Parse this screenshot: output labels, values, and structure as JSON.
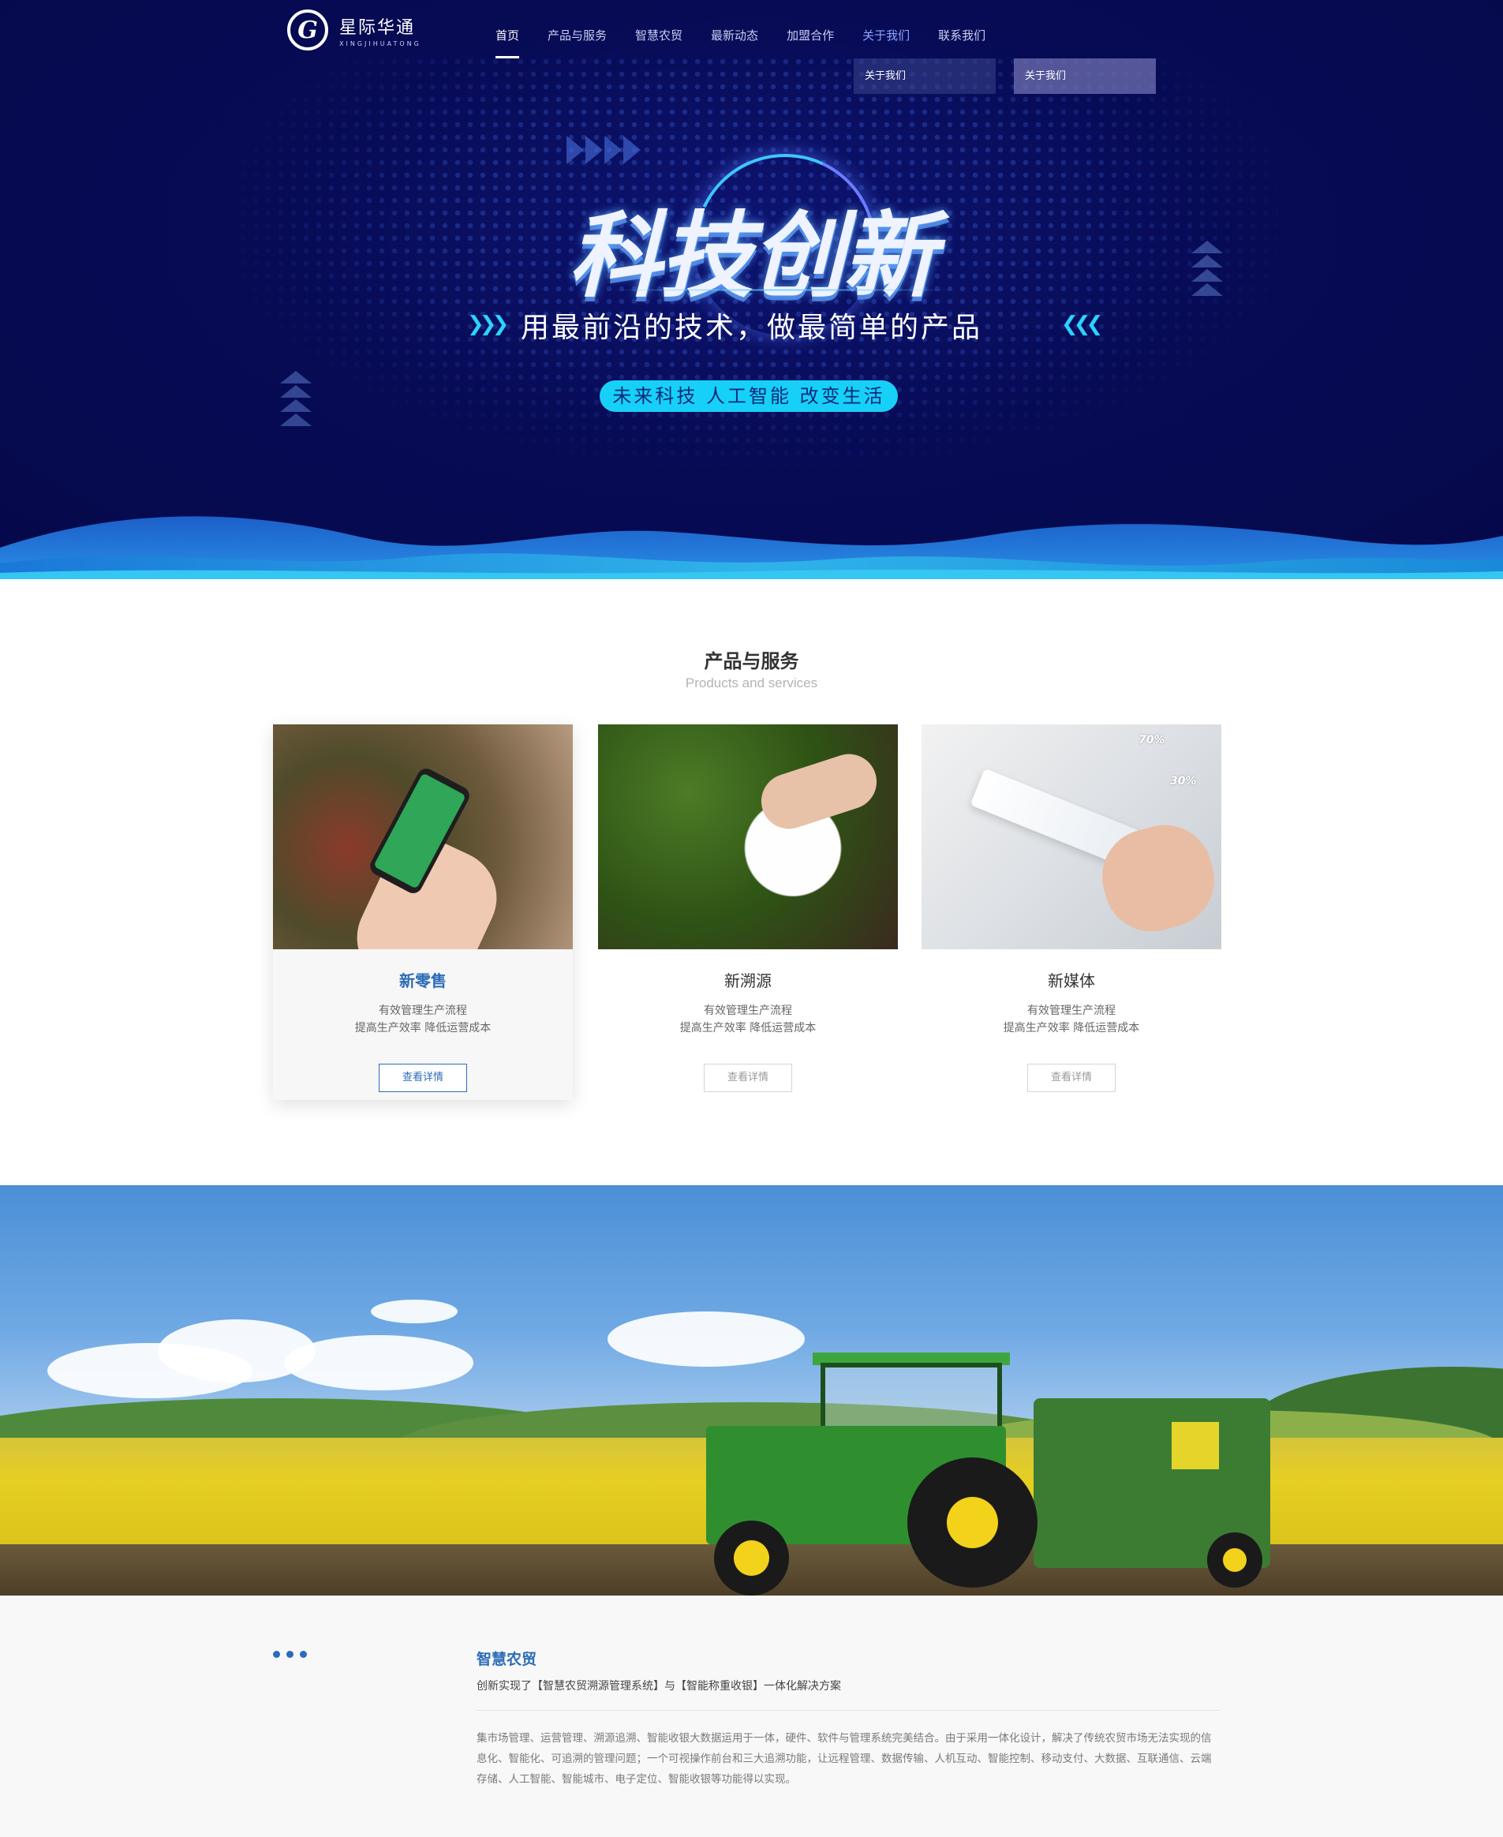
{
  "brand": {
    "name_cn": "星际华通",
    "name_en": "XINGJIHUATONG"
  },
  "nav": {
    "items": [
      {
        "label": "首页"
      },
      {
        "label": "产品与服务"
      },
      {
        "label": "智慧农贸"
      },
      {
        "label": "最新动态"
      },
      {
        "label": "加盟合作"
      },
      {
        "label": "关于我们"
      },
      {
        "label": "联系我们"
      }
    ],
    "active_index": 0,
    "dropdown": [
      "关于我们",
      "关于我们"
    ]
  },
  "hero": {
    "title": "科技创新",
    "subtitle": "用最前沿的技术，做最简单的产品",
    "tagline": "未来科技 人工智能 改变生活"
  },
  "products": {
    "title": "产品与服务",
    "subtitle": "Products and services",
    "cards": [
      {
        "name": "新零售",
        "desc_line1": "有效管理生产流程",
        "desc_line2": "提高生产效率 降低运营成本",
        "button": "查看详情"
      },
      {
        "name": "新溯源",
        "desc_line1": "有效管理生产流程",
        "desc_line2": "提高生产效率 降低运营成本",
        "button": "查看详情"
      },
      {
        "name": "新媒体",
        "desc_line1": "有效管理生产流程",
        "desc_line2": "提高生产效率 降低运营成本",
        "button": "查看详情"
      }
    ],
    "image_text": {
      "pct_high": "70%",
      "pct_low": "30%"
    }
  },
  "agri": {
    "title": "智慧农贸",
    "subtitle": "创新实现了【智慧农贸溯源管理系统】与【智能称重收银】一体化解决方案",
    "body": "集市场管理、运营管理、溯源追溯、智能收银大数据运用于一体，硬件、软件与管理系统完美结合。由于采用一体化设计，解决了传统农贸市场无法实现的信息化、智能化、可追溯的管理问题；一个可视操作前台和三大追溯功能，让远程管理、数据传输、人机互动、智能控制、移动支付、大数据、互联通信、云端存储、人工智能、智能城市、电子定位、智能收银等功能得以实现。"
  },
  "colors": {
    "hero_bg": "#070b55",
    "accent_cyan": "#17d0f7",
    "brand_blue": "#2c6cb8"
  }
}
